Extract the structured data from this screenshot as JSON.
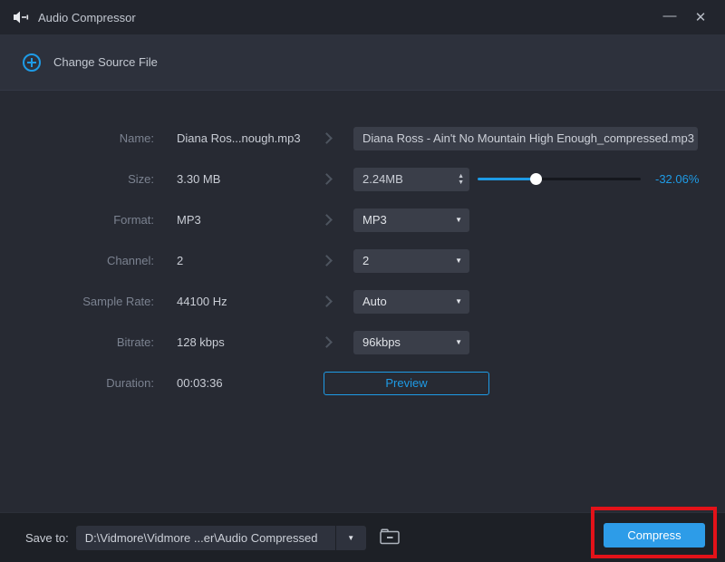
{
  "titlebar": {
    "title": "Audio Compressor"
  },
  "icons": {
    "minimize": "—",
    "close": "✕",
    "caret_down": "▼",
    "spin_up": "▲",
    "spin_down": "▼"
  },
  "source_bar": {
    "change_source_label": "Change Source File"
  },
  "rows": {
    "name": {
      "label": "Name:",
      "original": "Diana Ros...nough.mp3",
      "output": "Diana Ross - Ain't No Mountain High Enough_compressed.mp3"
    },
    "size": {
      "label": "Size:",
      "original": "3.30 MB",
      "target": "2.24MB",
      "reduction": "-32.06%",
      "slider_percent": 36
    },
    "format": {
      "label": "Format:",
      "original": "MP3",
      "selected": "MP3"
    },
    "channel": {
      "label": "Channel:",
      "original": "2",
      "selected": "2"
    },
    "sample_rate": {
      "label": "Sample Rate:",
      "original": "44100 Hz",
      "selected": "Auto"
    },
    "bitrate": {
      "label": "Bitrate:",
      "original": "128 kbps",
      "selected": "96kbps"
    },
    "duration": {
      "label": "Duration:",
      "original": "00:03:36",
      "preview_label": "Preview"
    }
  },
  "footer": {
    "save_to_label": "Save to:",
    "save_path": "D:\\Vidmore\\Vidmore ...er\\Audio Compressed",
    "compress_label": "Compress"
  },
  "colors": {
    "accent_blue": "#1e9be6",
    "compress_blue": "#2d9ce8",
    "annotation_red": "#e31219"
  }
}
